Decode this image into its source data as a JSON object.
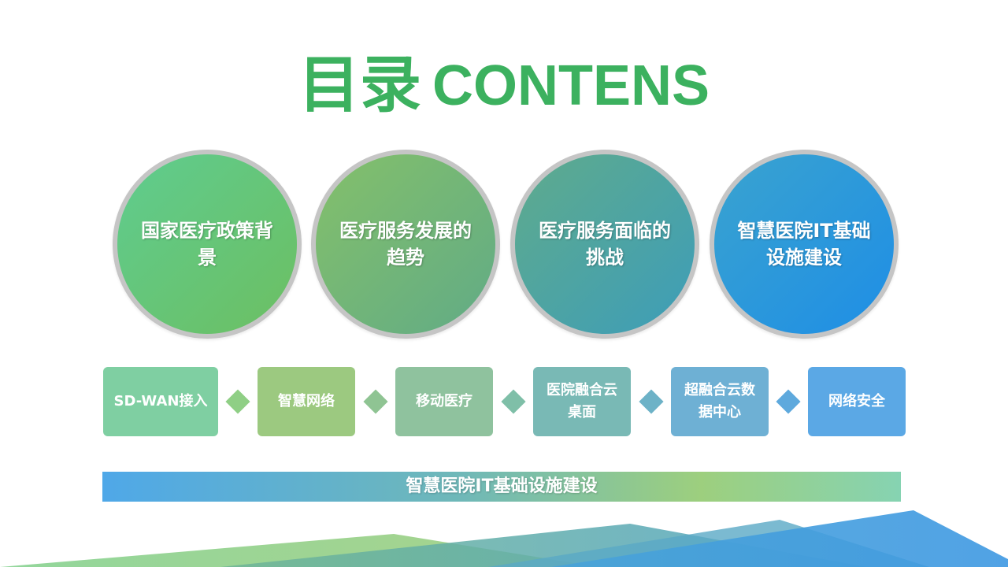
{
  "title": {
    "cn": "目录",
    "en": "CONTENS"
  },
  "circles": [
    {
      "label": "国家医疗政策背景"
    },
    {
      "label": "医疗服务发展的趋势"
    },
    {
      "label": "医疗服务面临的挑战"
    },
    {
      "label": "智慧医院IT基础设施建设"
    }
  ],
  "steps": [
    {
      "label": "SD-WAN接入"
    },
    {
      "label": "智慧网络"
    },
    {
      "label": "移动医疗"
    },
    {
      "label": "医院融合云桌面"
    },
    {
      "label": "超融合云数据中心"
    },
    {
      "label": "网络安全"
    }
  ],
  "banner": {
    "label": "智慧医院IT基础设施建设"
  },
  "colors": {
    "title": "#3cb15f",
    "circle_border": "#c5c5c5",
    "accent_blue": "#1e8ee6",
    "accent_green": "#6cbf62"
  }
}
